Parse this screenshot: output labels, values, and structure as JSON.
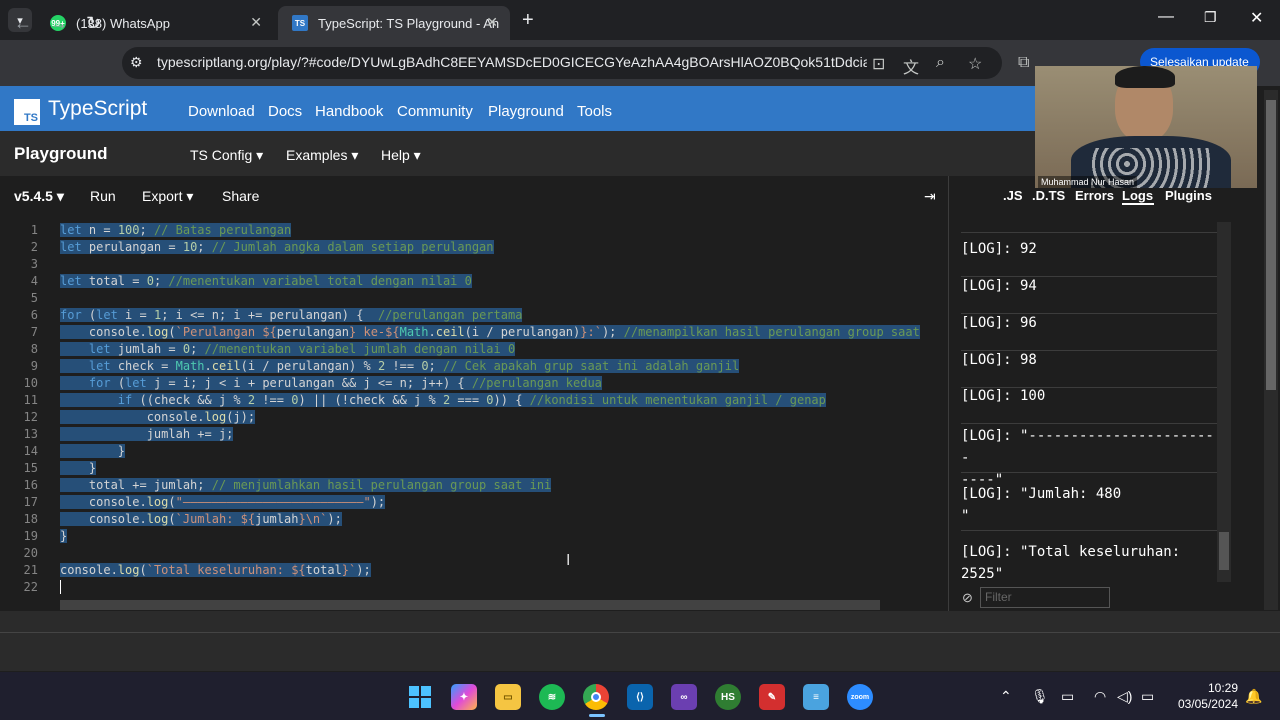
{
  "browser": {
    "tabs": [
      {
        "title": "(138) WhatsApp",
        "badge": "99+"
      },
      {
        "title": "TypeScript: TS Playground - An",
        "badge": "TS"
      }
    ],
    "new_tab": "+",
    "url": "typescriptlang.org/play/?#code/DYUwLgBAdhC8EEYAMSDcED0GICECGYeAzhAA4gBOArsHlAOZ0BQok51tDdciam...",
    "update_btn": "Selesaikan update"
  },
  "ts_header": {
    "logo_text": "TS",
    "brand": "TypeScript",
    "nav": [
      "Download",
      "Docs",
      "Handbook",
      "Community",
      "Playground",
      "Tools"
    ]
  },
  "playground": {
    "title": "Playground",
    "menus": [
      "TS Config ▾",
      "Examples ▾",
      "Help ▾"
    ],
    "toolbar": {
      "version": "v5.4.5 ▾",
      "run": "Run",
      "export": "Export ▾",
      "share": "Share",
      "expand": "⇥"
    }
  },
  "editor": {
    "line_numbers": [
      "1",
      "2",
      "3",
      "4",
      "5",
      "6",
      "7",
      "8",
      "9",
      "10",
      "11",
      "12",
      "13",
      "14",
      "15",
      "16",
      "17",
      "18",
      "19",
      "20",
      "21",
      "22"
    ]
  },
  "right_panel": {
    "tabs": [
      ".JS",
      ".D.TS",
      "Errors",
      "Logs",
      "Plugins"
    ],
    "logs": [
      "[LOG]: 92",
      "[LOG]: 94",
      "[LOG]: 96",
      "[LOG]: 98",
      "[LOG]: 100",
      "[LOG]: \"-----------------------\n----\"",
      "[LOG]: \"Jumlah: 480\n\"",
      "[LOG]: \"Total keseluruhan:\n2525\""
    ],
    "filter_placeholder": "Filter"
  },
  "video": {
    "name": "Muhammad Nur Hasan"
  },
  "taskbar": {
    "time": "10:29",
    "date": "03/05/2024"
  }
}
